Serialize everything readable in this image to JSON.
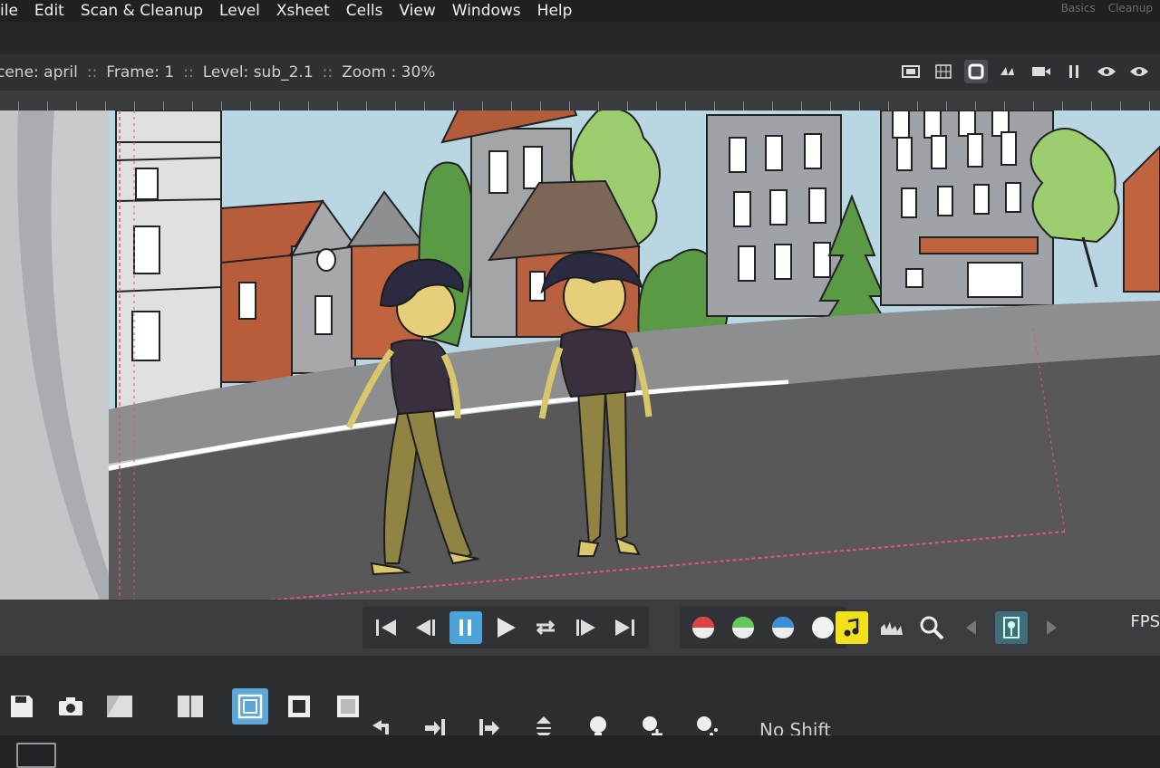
{
  "menu": [
    "ile",
    "Edit",
    "Scan & Cleanup",
    "Level",
    "Xsheet",
    "Cells",
    "View",
    "Windows",
    "Help"
  ],
  "rooms": [
    "Basics",
    "Cleanup"
  ],
  "viewer_info": {
    "scene": "cene: april",
    "frame": "Frame: 1",
    "level": "Level: sub_2.1",
    "zoom": "Zoom : 30%",
    "separator": "::"
  },
  "view_buttons": [
    "camera-stand-view-icon",
    "3d-view-icon",
    "camera-view-icon",
    "table-view-icon",
    "camera-icon",
    "freeze-icon",
    "preview-icon",
    "sub-camera-preview-icon"
  ],
  "playback": {
    "controls": [
      "first-frame-icon",
      "prev-frame-icon",
      "pause-icon",
      "play-icon",
      "loop-icon",
      "next-frame-icon",
      "last-frame-icon"
    ],
    "channels": [
      "red-channel-icon",
      "green-channel-icon",
      "blue-channel-icon",
      "alpha-channel-icon"
    ],
    "extra": [
      "sound-icon",
      "histogram-icon",
      "zoom-icon",
      "prev-marker-icon",
      "marker-icon",
      "next-marker-icon"
    ],
    "fps_label": "FPS"
  },
  "onion_shift": {
    "label": "No Shift"
  },
  "colors": {
    "sky": "#b9d7e2",
    "road": "#58585a",
    "sidewalk": "#8d8e90",
    "accent": "#4aa3d9",
    "camera_box": "#e0508a"
  }
}
